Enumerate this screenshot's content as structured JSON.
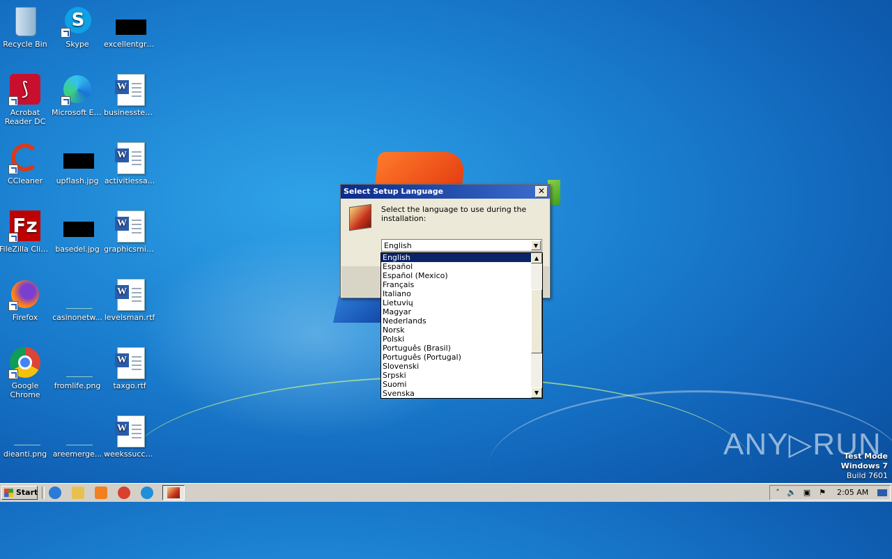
{
  "desktop": {
    "icons": [
      {
        "label": "Recycle Bin"
      },
      {
        "label": "Skype"
      },
      {
        "label": "excellentgra..."
      },
      {
        "label": "Acrobat Reader DC"
      },
      {
        "label": "Microsoft Edge"
      },
      {
        "label": "businesstes..."
      },
      {
        "label": "CCleaner"
      },
      {
        "label": "upflash.jpg"
      },
      {
        "label": "activitiessa..."
      },
      {
        "label": "FileZilla Client"
      },
      {
        "label": "basedel.jpg"
      },
      {
        "label": "graphicsmik..."
      },
      {
        "label": "Firefox"
      },
      {
        "label": "casinonetw..."
      },
      {
        "label": "levelsman.rtf"
      },
      {
        "label": "Google Chrome"
      },
      {
        "label": "fromlife.png"
      },
      {
        "label": "taxgo.rtf"
      },
      {
        "label": "dieanti.png"
      },
      {
        "label": "areemerge..."
      },
      {
        "label": "weekssucce..."
      }
    ]
  },
  "dialog": {
    "title": "Select Setup Language",
    "close_glyph": "✕",
    "prompt": "Select the language to use during the installation:",
    "selected_language": "English",
    "languages": [
      "English",
      "Español",
      "Español (Mexico)",
      "Français",
      "Italiano",
      "Lietuvių",
      "Magyar",
      "Nederlands",
      "Norsk",
      "Polski",
      "Português (Brasil)",
      "Português (Portugal)",
      "Slovenski",
      "Srpski",
      "Suomi",
      "Svenska"
    ]
  },
  "watermark": {
    "brand": "ANY▷RUN",
    "line1": "Test Mode",
    "line2": "Windows 7",
    "line3": "Build 7601"
  },
  "taskbar": {
    "start_label": "Start",
    "clock": "2:05 AM",
    "pinned": [
      {
        "icon": "internet-explorer-icon",
        "color": "#2a7bd6"
      },
      {
        "icon": "explorer-folder-icon",
        "color": "#e8c050"
      },
      {
        "icon": "media-player-icon",
        "color": "#f08020"
      },
      {
        "icon": "chrome-icon",
        "color": "#d94030"
      },
      {
        "icon": "edge-icon",
        "color": "#1e8fd8"
      }
    ]
  }
}
